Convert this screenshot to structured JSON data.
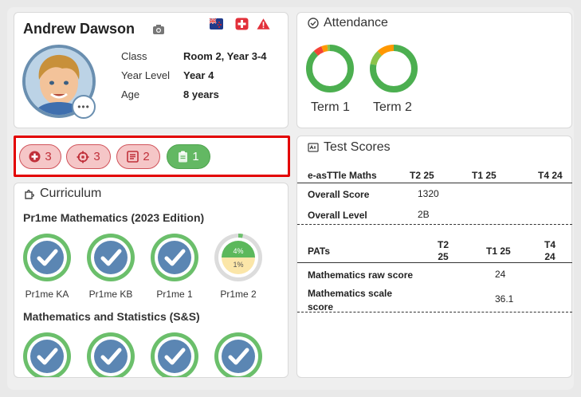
{
  "student": {
    "name": "Andrew Dawson",
    "fields": [
      {
        "label": "Class",
        "value": "Room 2, Year 3-4"
      },
      {
        "label": "Year Level",
        "value": "Year 4"
      },
      {
        "label": "Age",
        "value": "8 years"
      }
    ],
    "icons": [
      "camera-icon",
      "nz-flag-icon",
      "medical-cross-icon",
      "warning-icon"
    ],
    "avatar_more": "•••"
  },
  "alerts": [
    {
      "icon": "medical-plus-icon",
      "count": "3",
      "kind": "red"
    },
    {
      "icon": "target-icon",
      "count": "3",
      "kind": "red"
    },
    {
      "icon": "notice-icon",
      "count": "2",
      "kind": "red"
    },
    {
      "icon": "clipboard-icon",
      "count": "1",
      "kind": "green"
    }
  ],
  "attendance": {
    "title": "Attendance",
    "terms": [
      {
        "label": "Term 1",
        "segments": [
          {
            "color": "#4caf50",
            "value": 0.88
          },
          {
            "color": "#f44336",
            "value": 0.06
          },
          {
            "color": "#ff9800",
            "value": 0.04
          },
          {
            "color": "#8bc34a",
            "value": 0.02
          }
        ]
      },
      {
        "label": "Term 2",
        "segments": [
          {
            "color": "#4caf50",
            "value": 0.78
          },
          {
            "color": "#8bc34a",
            "value": 0.1
          },
          {
            "color": "#ff9800",
            "value": 0.12
          }
        ]
      }
    ]
  },
  "curriculum": {
    "title": "Curriculum",
    "sections": [
      {
        "title": "Pr1me Mathematics (2023 Edition)",
        "items": [
          {
            "label": "Pr1me KA",
            "complete": true
          },
          {
            "label": "Pr1me KB",
            "complete": true
          },
          {
            "label": "Pr1me 1",
            "complete": true
          },
          {
            "label": "Pr1me 2",
            "complete": false,
            "top": "4%",
            "bottom": "1%"
          }
        ]
      },
      {
        "title": "Mathematics and Statistics (S&S)",
        "items": [
          {
            "label": "",
            "complete": true
          },
          {
            "label": "",
            "complete": true
          },
          {
            "label": "",
            "complete": true
          },
          {
            "label": "",
            "complete": true
          }
        ]
      }
    ]
  },
  "tests": {
    "title": "Test Scores",
    "easttle": {
      "heading": "e-asTTle Maths",
      "cols": [
        "T2 25",
        "T1 25",
        "T4 24"
      ],
      "rows": [
        {
          "label": "Overall Score",
          "values": [
            "1320",
            "",
            ""
          ]
        },
        {
          "label": "Overall Level",
          "values": [
            "2B",
            "",
            ""
          ]
        }
      ]
    },
    "pats": {
      "heading": "PATs",
      "cols": [
        "T2\n25",
        "T1 25",
        "T4\n24"
      ],
      "rows": [
        {
          "label": "Mathematics raw score",
          "values": [
            "",
            "24",
            ""
          ]
        },
        {
          "label": "Mathematics scale score",
          "values": [
            "",
            "36.1",
            ""
          ]
        }
      ]
    }
  }
}
